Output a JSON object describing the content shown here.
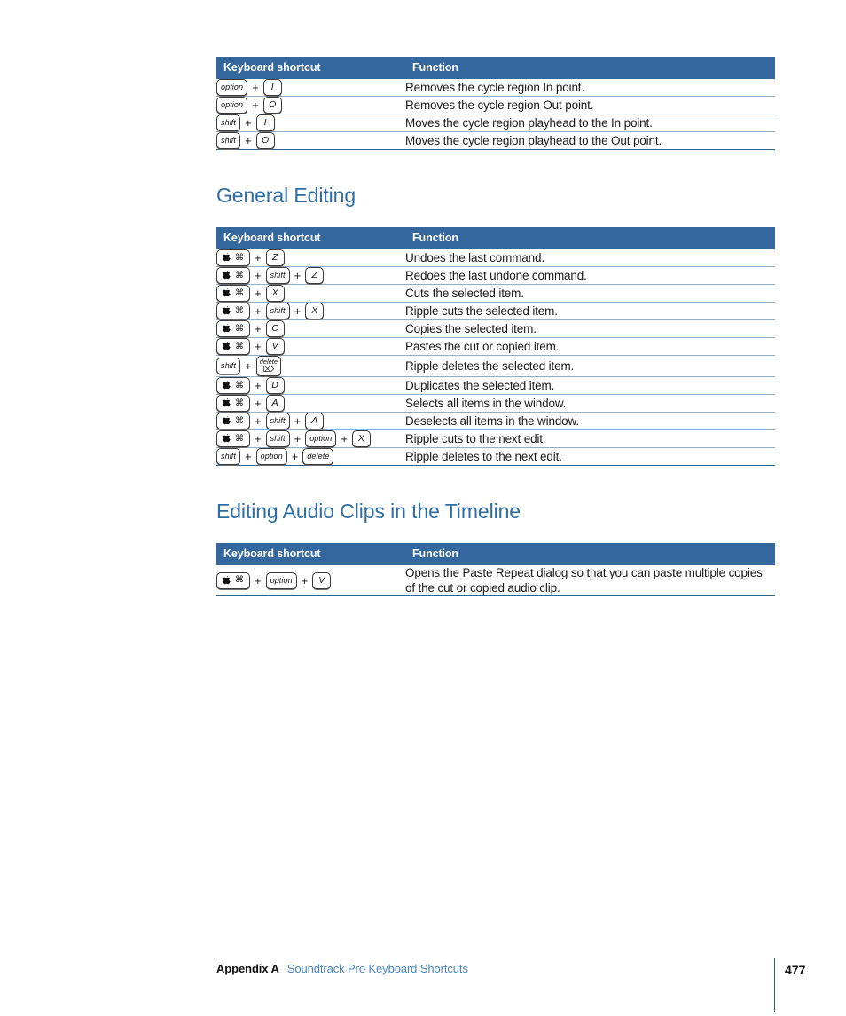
{
  "document": {
    "page_number": "477",
    "footer": {
      "appendix_label": "Appendix A",
      "title": "Soundtrack Pro Keyboard Shortcuts"
    },
    "colors": {
      "table_header_bg": "#33679e",
      "heading_blue": "#2e6da4",
      "row_separator": "#8fb0cd",
      "table_bottom_rule": "#2b618f",
      "footer_link": "#4b86c2"
    }
  },
  "columns": {
    "keyboard_shortcut": "Keyboard shortcut",
    "function": "Function"
  },
  "sections": [
    {
      "heading": null,
      "rows": [
        {
          "keys": [
            {
              "type": "word",
              "label": "option"
            },
            {
              "type": "letter",
              "label": "I"
            }
          ],
          "function": "Removes the cycle region In point."
        },
        {
          "keys": [
            {
              "type": "word",
              "label": "option"
            },
            {
              "type": "letter",
              "label": "O"
            }
          ],
          "function": "Removes the cycle region Out point."
        },
        {
          "keys": [
            {
              "type": "word",
              "label": "shift"
            },
            {
              "type": "letter",
              "label": "I"
            }
          ],
          "function": "Moves the cycle region playhead to the In point."
        },
        {
          "keys": [
            {
              "type": "word",
              "label": "shift"
            },
            {
              "type": "letter",
              "label": "O"
            }
          ],
          "function": "Moves the cycle region playhead to the Out point."
        }
      ]
    },
    {
      "heading": "General Editing",
      "rows": [
        {
          "keys": [
            {
              "type": "command",
              "label": "Command"
            },
            {
              "type": "letter",
              "label": "Z"
            }
          ],
          "function": "Undoes the last command."
        },
        {
          "keys": [
            {
              "type": "command",
              "label": "Command"
            },
            {
              "type": "word",
              "label": "shift"
            },
            {
              "type": "letter",
              "label": "Z"
            }
          ],
          "function": "Redoes the last undone command."
        },
        {
          "keys": [
            {
              "type": "command",
              "label": "Command"
            },
            {
              "type": "letter",
              "label": "X"
            }
          ],
          "function": "Cuts the selected item."
        },
        {
          "keys": [
            {
              "type": "command",
              "label": "Command"
            },
            {
              "type": "word",
              "label": "shift"
            },
            {
              "type": "letter",
              "label": "X"
            }
          ],
          "function": "Ripple cuts the selected item."
        },
        {
          "keys": [
            {
              "type": "command",
              "label": "Command"
            },
            {
              "type": "letter",
              "label": "C"
            }
          ],
          "function": "Copies the selected item."
        },
        {
          "keys": [
            {
              "type": "command",
              "label": "Command"
            },
            {
              "type": "letter",
              "label": "V"
            }
          ],
          "function": "Pastes the cut or copied item."
        },
        {
          "keys": [
            {
              "type": "word",
              "label": "shift"
            },
            {
              "type": "stack",
              "label": "delete",
              "label2": "⌦"
            }
          ],
          "function": "Ripple deletes the selected item."
        },
        {
          "keys": [
            {
              "type": "command",
              "label": "Command"
            },
            {
              "type": "letter",
              "label": "D"
            }
          ],
          "function": "Duplicates the selected item."
        },
        {
          "keys": [
            {
              "type": "command",
              "label": "Command"
            },
            {
              "type": "letter",
              "label": "A"
            }
          ],
          "function": "Selects all items in the window."
        },
        {
          "keys": [
            {
              "type": "command",
              "label": "Command"
            },
            {
              "type": "word",
              "label": "shift"
            },
            {
              "type": "letter",
              "label": "A"
            }
          ],
          "function": "Deselects all items in the window."
        },
        {
          "keys": [
            {
              "type": "command",
              "label": "Command"
            },
            {
              "type": "word",
              "label": "shift"
            },
            {
              "type": "word",
              "label": "option"
            },
            {
              "type": "letter",
              "label": "X"
            }
          ],
          "function": "Ripple cuts to the next edit."
        },
        {
          "keys": [
            {
              "type": "word",
              "label": "shift"
            },
            {
              "type": "word",
              "label": "option"
            },
            {
              "type": "word",
              "label": "delete"
            }
          ],
          "function": "Ripple deletes to the next edit."
        }
      ]
    },
    {
      "heading": "Editing Audio Clips in the Timeline",
      "rows": [
        {
          "keys": [
            {
              "type": "command",
              "label": "Command"
            },
            {
              "type": "word",
              "label": "option"
            },
            {
              "type": "letter",
              "label": "V"
            }
          ],
          "function": "Opens the Paste Repeat dialog so that you can paste multiple copies of the cut or copied audio clip."
        }
      ]
    }
  ]
}
